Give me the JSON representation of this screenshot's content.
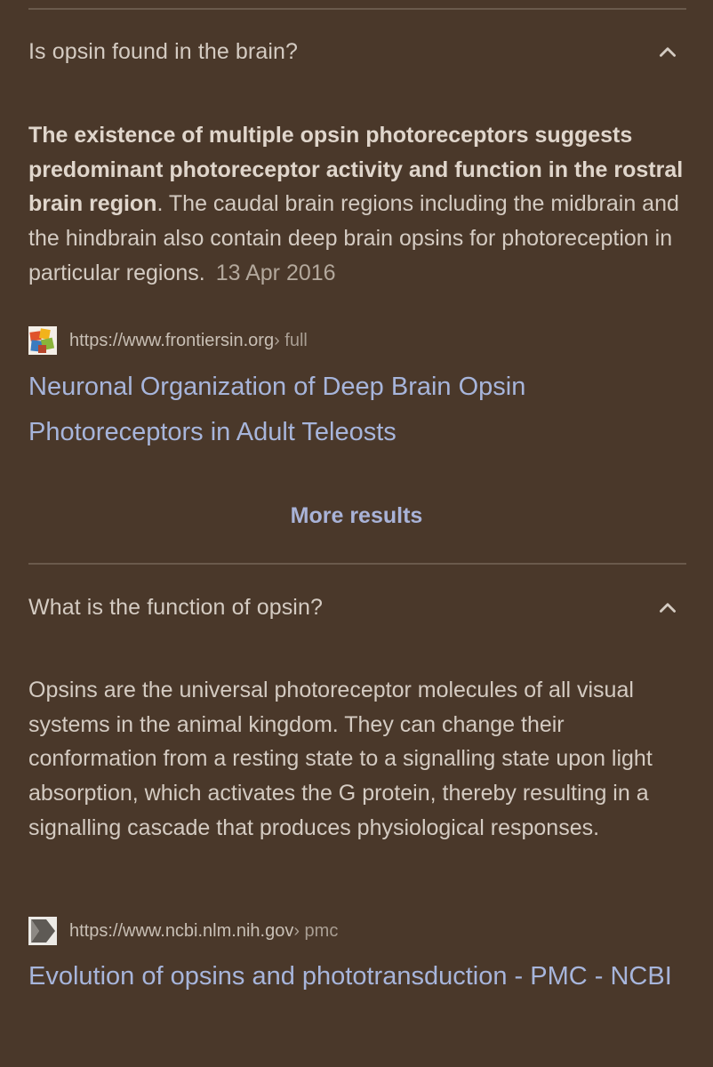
{
  "faq": [
    {
      "question": "Is opsin found in the brain?",
      "answer_bold": "The existence of multiple opsin photoreceptors suggests predominant photoreceptor activity and function in the rostral brain region",
      "answer_rest": ". The caudal brain regions including the midbrain and the hindbrain also contain deep brain opsins for photoreception in particular regions.",
      "date": "13 Apr 2016",
      "source_url": "https://www.frontiersin.org",
      "source_path": " › full",
      "link_title": "Neuronal Organization of Deep Brain Opsin Photoreceptors in Adult Teleosts"
    },
    {
      "question": "What is the function of opsin?",
      "answer": "Opsins are the universal photoreceptor molecules of all visual systems in the animal kingdom. They can change their conformation from a resting state to a signalling state upon light absorption, which activates the G protein, thereby resulting in a signalling cascade that produces physiological responses.",
      "source_url": "https://www.ncbi.nlm.nih.gov",
      "source_path": " › pmc",
      "link_title": "Evolution of opsins and phototransduction - PMC - NCBI"
    }
  ],
  "more_results_label": "More results",
  "icons": {
    "chevron": "chevron-up-icon",
    "favicon_1": "frontiers-favicon-icon",
    "favicon_2": "ncbi-favicon-icon"
  },
  "colors": {
    "background": "#4a382a",
    "link": "#a7b5db",
    "text": "#d4cbc2"
  }
}
